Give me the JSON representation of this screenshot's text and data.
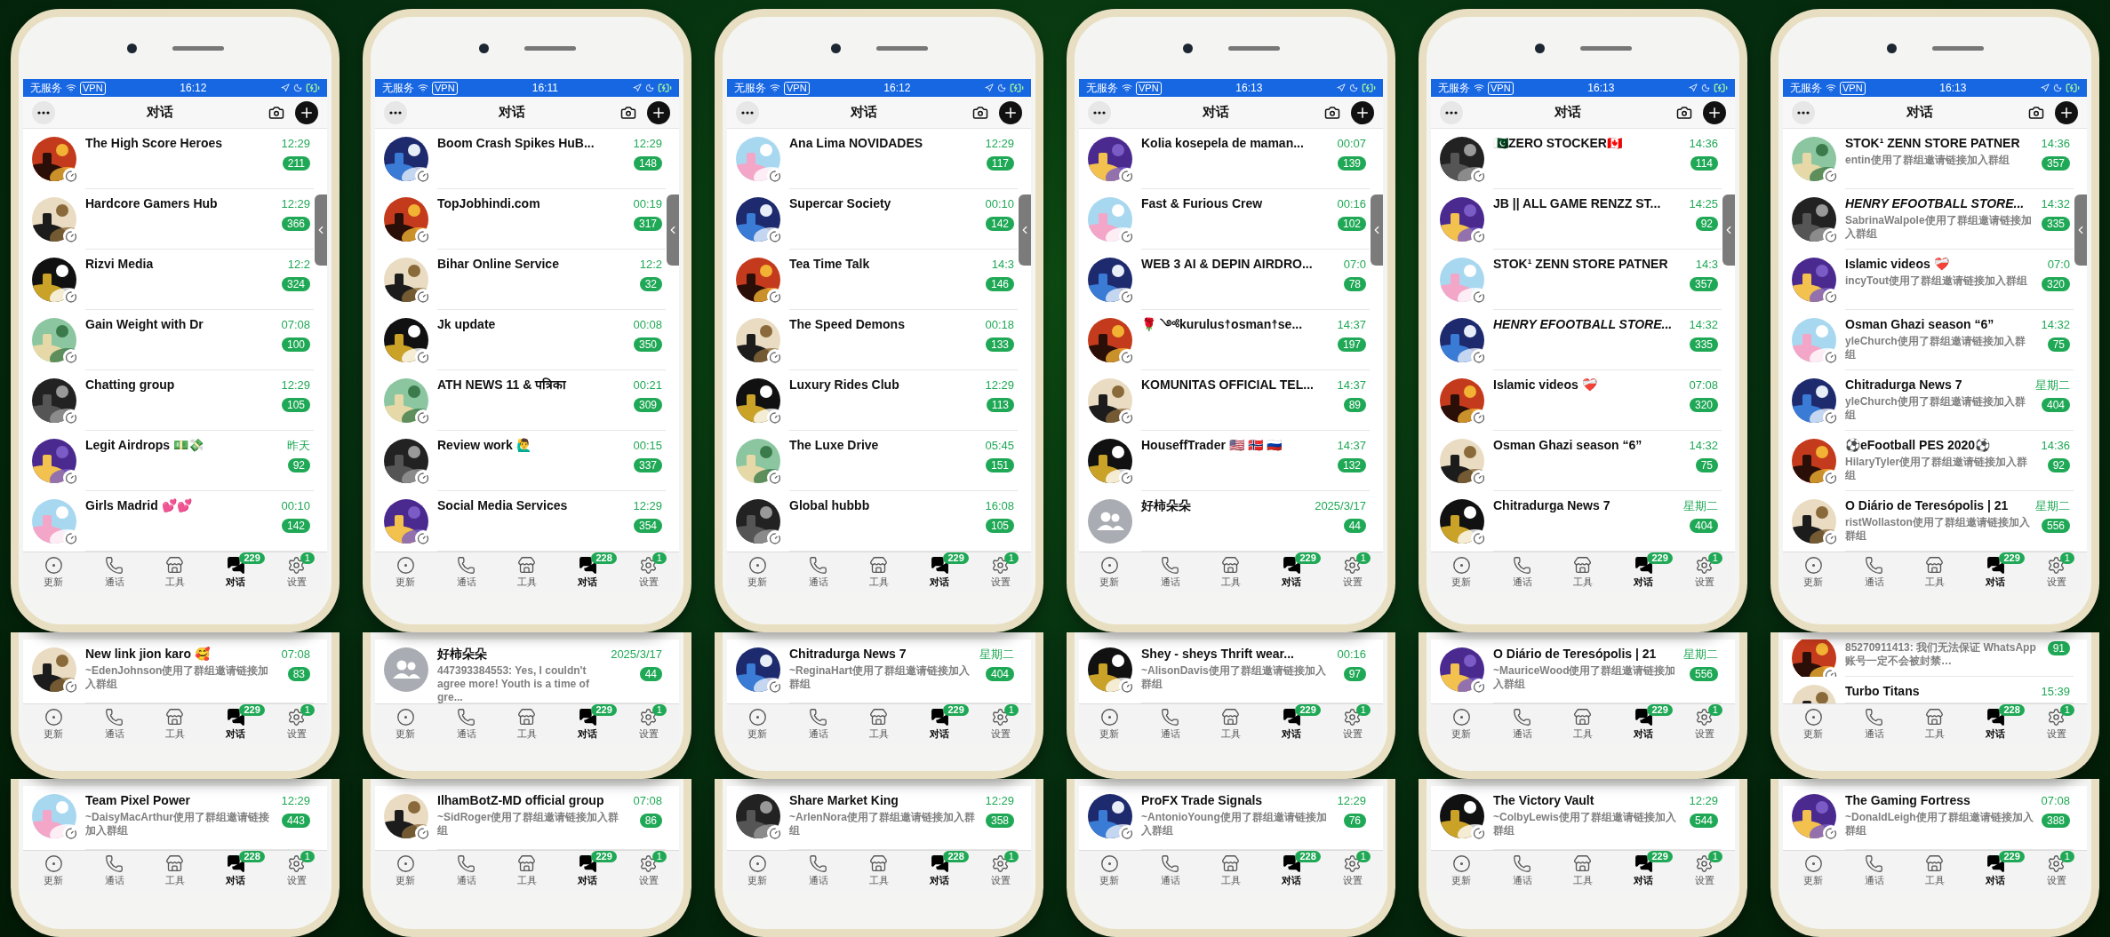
{
  "phones": [
    {
      "status": {
        "carrier": "无服务",
        "vpn": "VPN",
        "time": "16:12"
      },
      "header": {
        "title": "对话"
      },
      "chats": [
        {
          "name": "The High Score Heroes",
          "time": "12:29",
          "count": "211",
          "group": false
        },
        {
          "name": "Hardcore Gamers Hub",
          "time": "12:29",
          "count": "366",
          "group": false
        },
        {
          "name": "Rizvi Media",
          "time": "12:2",
          "count": "324",
          "group": false
        },
        {
          "name": "Gain Weight with Dr",
          "time": "07:08",
          "count": "100",
          "group": false
        },
        {
          "name": "Chatting group",
          "time": "12:29",
          "count": "105",
          "group": false
        },
        {
          "name": "Legit Airdrops 💵💸",
          "time": "昨天",
          "count": "92",
          "group": false
        },
        {
          "name": "Girls Madrid 💕💕",
          "time": "00:10",
          "count": "142",
          "group": false
        }
      ],
      "tabs": [
        {
          "kind": "updates",
          "label": "更新",
          "selected": false
        },
        {
          "kind": "calls",
          "label": "通话",
          "selected": false
        },
        {
          "kind": "tools",
          "label": "工具",
          "selected": false
        },
        {
          "kind": "chats",
          "label": "对话",
          "selected": true,
          "badge": "229"
        },
        {
          "kind": "settings",
          "label": "设置",
          "selected": false,
          "badge": "1"
        }
      ],
      "cards": [
        {
          "chats": [
            {
              "name": "New link jion karo 🥰",
              "preview": "~EdenJohnson使用了群组邀请链接加入群组",
              "time": "07:08",
              "count": "83",
              "group": false
            }
          ],
          "tabs": [
            {
              "kind": "updates",
              "label": "更新",
              "selected": false
            },
            {
              "kind": "calls",
              "label": "通话",
              "selected": false
            },
            {
              "kind": "tools",
              "label": "工具",
              "selected": false
            },
            {
              "kind": "chats",
              "label": "对话",
              "selected": true,
              "badge": "229"
            },
            {
              "kind": "settings",
              "label": "设置",
              "selected": false,
              "badge": "1"
            }
          ]
        },
        {
          "chats": [
            {
              "name": "Team Pixel Power",
              "preview": "~DaisyMacArthur使用了群组邀请链接加入群组",
              "time": "12:29",
              "count": "443",
              "group": false
            }
          ],
          "tabs": [
            {
              "kind": "updates",
              "label": "更新",
              "selected": false
            },
            {
              "kind": "calls",
              "label": "通话",
              "selected": false
            },
            {
              "kind": "tools",
              "label": "工具",
              "selected": false
            },
            {
              "kind": "chats",
              "label": "对话",
              "selected": true,
              "badge": "228"
            },
            {
              "kind": "settings",
              "label": "设置",
              "selected": false,
              "badge": "1"
            }
          ]
        }
      ]
    },
    {
      "status": {
        "carrier": "无服务",
        "vpn": "VPN",
        "time": "16:11"
      },
      "header": {
        "title": "对话"
      },
      "chats": [
        {
          "name": "Boom Crash Spikes HuB...",
          "time": "12:29",
          "count": "148",
          "group": false
        },
        {
          "name": "TopJobhindi.com",
          "time": "00:19",
          "count": "317",
          "group": false
        },
        {
          "name": "Bihar Online Service",
          "time": "12:2",
          "count": "32",
          "group": false
        },
        {
          "name": "Jk update",
          "time": "00:08",
          "count": "350",
          "group": false
        },
        {
          "name": "ATH NEWS 11 & पत्रिका",
          "time": "00:21",
          "count": "309",
          "group": false
        },
        {
          "name": "Review work 🙋‍♂️",
          "time": "00:15",
          "count": "337",
          "group": false
        },
        {
          "name": "Social Media Services",
          "time": "12:29",
          "count": "354",
          "group": false
        }
      ],
      "tabs": [
        {
          "kind": "updates",
          "label": "更新",
          "selected": false
        },
        {
          "kind": "calls",
          "label": "通话",
          "selected": false
        },
        {
          "kind": "tools",
          "label": "工具",
          "selected": false
        },
        {
          "kind": "chats",
          "label": "对话",
          "selected": true,
          "badge": "228"
        },
        {
          "kind": "settings",
          "label": "设置",
          "selected": false,
          "badge": "1"
        }
      ],
      "cards": [
        {
          "chats": [
            {
              "name": "好柿朵朵",
              "preview": "447393384553: Yes, I couldn't agree more! Youth is a time of gre...",
              "time": "2025/3/17",
              "count": "44",
              "group": true
            }
          ],
          "tabs": [
            {
              "kind": "updates",
              "label": "更新",
              "selected": false
            },
            {
              "kind": "calls",
              "label": "通话",
              "selected": false
            },
            {
              "kind": "tools",
              "label": "工具",
              "selected": false
            },
            {
              "kind": "chats",
              "label": "对话",
              "selected": true,
              "badge": "229"
            },
            {
              "kind": "settings",
              "label": "设置",
              "selected": false,
              "badge": "1"
            }
          ]
        },
        {
          "chats": [
            {
              "name": "IlhamBotZ-MD official group",
              "preview": "~SidRoger使用了群组邀请链接加入群组",
              "time": "07:08",
              "count": "86",
              "group": false
            }
          ],
          "tabs": [
            {
              "kind": "updates",
              "label": "更新",
              "selected": false
            },
            {
              "kind": "calls",
              "label": "通话",
              "selected": false
            },
            {
              "kind": "tools",
              "label": "工具",
              "selected": false
            },
            {
              "kind": "chats",
              "label": "对话",
              "selected": true,
              "badge": "229"
            },
            {
              "kind": "settings",
              "label": "设置",
              "selected": false,
              "badge": "1"
            }
          ]
        }
      ]
    },
    {
      "status": {
        "carrier": "无服务",
        "vpn": "VPN",
        "time": "16:12"
      },
      "header": {
        "title": "对话"
      },
      "chats": [
        {
          "name": "Ana Lima NOVIDADES",
          "time": "12:29",
          "count": "117",
          "group": false
        },
        {
          "name": "Supercar Society",
          "time": "00:10",
          "count": "142",
          "group": false
        },
        {
          "name": "Tea Time Talk",
          "time": "14:3",
          "count": "146",
          "group": false
        },
        {
          "name": "The Speed Demons",
          "time": "00:18",
          "count": "133",
          "group": false
        },
        {
          "name": "Luxury Rides Club",
          "time": "12:29",
          "count": "113",
          "group": false
        },
        {
          "name": "The Luxe Drive",
          "time": "05:45",
          "count": "151",
          "group": false
        },
        {
          "name": "Global hubbb",
          "time": "16:08",
          "count": "105",
          "group": false
        }
      ],
      "tabs": [
        {
          "kind": "updates",
          "label": "更新",
          "selected": false
        },
        {
          "kind": "calls",
          "label": "通话",
          "selected": false
        },
        {
          "kind": "tools",
          "label": "工具",
          "selected": false
        },
        {
          "kind": "chats",
          "label": "对话",
          "selected": true,
          "badge": "229"
        },
        {
          "kind": "settings",
          "label": "设置",
          "selected": false,
          "badge": "1"
        }
      ],
      "cards": [
        {
          "chats": [
            {
              "name": "Chitradurga News 7",
              "preview": "~ReginaHart使用了群组邀请链接加入群组",
              "time": "星期二",
              "count": "404",
              "group": false
            }
          ],
          "tabs": [
            {
              "kind": "updates",
              "label": "更新",
              "selected": false
            },
            {
              "kind": "calls",
              "label": "通话",
              "selected": false
            },
            {
              "kind": "tools",
              "label": "工具",
              "selected": false
            },
            {
              "kind": "chats",
              "label": "对话",
              "selected": true,
              "badge": "229"
            },
            {
              "kind": "settings",
              "label": "设置",
              "selected": false,
              "badge": "1"
            }
          ]
        },
        {
          "chats": [
            {
              "name": "Share Market King",
              "preview": "~ArlenNora使用了群组邀请链接加入群组",
              "time": "12:29",
              "count": "358",
              "group": false
            }
          ],
          "tabs": [
            {
              "kind": "updates",
              "label": "更新",
              "selected": false
            },
            {
              "kind": "calls",
              "label": "通话",
              "selected": false
            },
            {
              "kind": "tools",
              "label": "工具",
              "selected": false
            },
            {
              "kind": "chats",
              "label": "对话",
              "selected": true,
              "badge": "228"
            },
            {
              "kind": "settings",
              "label": "设置",
              "selected": false,
              "badge": "1"
            }
          ]
        }
      ]
    },
    {
      "status": {
        "carrier": "无服务",
        "vpn": "VPN",
        "time": "16:13"
      },
      "header": {
        "title": "对话"
      },
      "chats": [
        {
          "name": "Kolia kosepela de maman...",
          "time": "00:07",
          "count": "139",
          "group": false
        },
        {
          "name": "Fast & Furious Crew",
          "time": "00:16",
          "count": "102",
          "group": false
        },
        {
          "name": "WEB 3 AI & DEPIN AIRDRO...",
          "time": "07:0",
          "count": "78",
          "group": false
        },
        {
          "name": "🌹 ༺kurulus☨osman☨se...",
          "time": "14:37",
          "count": "197",
          "group": false
        },
        {
          "name": "KOMUNITAS OFFICIAL TEL...",
          "time": "14:37",
          "count": "89",
          "group": false
        },
        {
          "name": "HouseffTrader 🇺🇸 🇳🇴 🇷🇺",
          "time": "14:37",
          "count": "132",
          "group": false
        },
        {
          "name": "好柿朵朵",
          "time": "2025/3/17",
          "count": "44",
          "group": true
        }
      ],
      "tabs": [
        {
          "kind": "updates",
          "label": "更新",
          "selected": false
        },
        {
          "kind": "calls",
          "label": "通话",
          "selected": false
        },
        {
          "kind": "tools",
          "label": "工具",
          "selected": false
        },
        {
          "kind": "chats",
          "label": "对话",
          "selected": true,
          "badge": "229"
        },
        {
          "kind": "settings",
          "label": "设置",
          "selected": false,
          "badge": "1"
        }
      ],
      "cards": [
        {
          "chats": [
            {
              "name": "Shey - sheys Thrift wear...",
              "preview": "~AlisonDavis使用了群组邀请链接加入群组",
              "time": "00:16",
              "count": "97",
              "group": false
            }
          ],
          "tabs": [
            {
              "kind": "updates",
              "label": "更新",
              "selected": false
            },
            {
              "kind": "calls",
              "label": "通话",
              "selected": false
            },
            {
              "kind": "tools",
              "label": "工具",
              "selected": false
            },
            {
              "kind": "chats",
              "label": "对话",
              "selected": true,
              "badge": "229"
            },
            {
              "kind": "settings",
              "label": "设置",
              "selected": false,
              "badge": "1"
            }
          ]
        },
        {
          "chats": [
            {
              "name": "ProFX Trade Signals",
              "preview": "~AntonioYoung使用了群组邀请链接加入群组",
              "time": "12:29",
              "count": "76",
              "group": false
            }
          ],
          "tabs": [
            {
              "kind": "updates",
              "label": "更新",
              "selected": false
            },
            {
              "kind": "calls",
              "label": "通话",
              "selected": false
            },
            {
              "kind": "tools",
              "label": "工具",
              "selected": false
            },
            {
              "kind": "chats",
              "label": "对话",
              "selected": true,
              "badge": "228"
            },
            {
              "kind": "settings",
              "label": "设置",
              "selected": false,
              "badge": "1"
            }
          ]
        }
      ]
    },
    {
      "status": {
        "carrier": "无服务",
        "vpn": "VPN",
        "time": "16:13"
      },
      "header": {
        "title": "对话"
      },
      "chats": [
        {
          "name": "🇵🇰ZERO STOCKER🇨🇦",
          "time": "14:36",
          "count": "114",
          "group": false
        },
        {
          "name": "JB || ALL GAME RENZZ ST...",
          "time": "14:25",
          "count": "92",
          "group": false
        },
        {
          "name": "STOK¹ ZENN STORE PATNER",
          "time": "14:3",
          "count": "357",
          "group": false
        },
        {
          "name": "HENRY EFOOTBALL STORE...",
          "italic": true,
          "time": "14:32",
          "count": "335",
          "group": false
        },
        {
          "name": "Islamic videos ❤️‍🩹",
          "time": "07:08",
          "count": "320",
          "group": false
        },
        {
          "name": "Osman Ghazi season “6”",
          "time": "14:32",
          "count": "75",
          "group": false
        },
        {
          "name": "Chitradurga News 7",
          "time": "星期二",
          "count": "404",
          "group": false
        }
      ],
      "tabs": [
        {
          "kind": "updates",
          "label": "更新",
          "selected": false
        },
        {
          "kind": "calls",
          "label": "通话",
          "selected": false
        },
        {
          "kind": "tools",
          "label": "工具",
          "selected": false
        },
        {
          "kind": "chats",
          "label": "对话",
          "selected": true,
          "badge": "229"
        },
        {
          "kind": "settings",
          "label": "设置",
          "selected": false,
          "badge": "1"
        }
      ],
      "cards": [
        {
          "chats": [
            {
              "name": "O Diário de Teresópolis | 21",
              "preview": "~MauriceWood使用了群组邀请链接加入群组",
              "time": "星期二",
              "count": "556",
              "group": false
            }
          ],
          "tabs": [
            {
              "kind": "updates",
              "label": "更新",
              "selected": false
            },
            {
              "kind": "calls",
              "label": "通话",
              "selected": false
            },
            {
              "kind": "tools",
              "label": "工具",
              "selected": false
            },
            {
              "kind": "chats",
              "label": "对话",
              "selected": true,
              "badge": "229"
            },
            {
              "kind": "settings",
              "label": "设置",
              "selected": false,
              "badge": "1"
            }
          ]
        },
        {
          "chats": [
            {
              "name": "The Victory Vault",
              "preview": "~ColbyLewis使用了群组邀请链接加入群组",
              "time": "12:29",
              "count": "544",
              "group": false
            }
          ],
          "tabs": [
            {
              "kind": "updates",
              "label": "更新",
              "selected": false
            },
            {
              "kind": "calls",
              "label": "通话",
              "selected": false
            },
            {
              "kind": "tools",
              "label": "工具",
              "selected": false
            },
            {
              "kind": "chats",
              "label": "对话",
              "selected": true,
              "badge": "229"
            },
            {
              "kind": "settings",
              "label": "设置",
              "selected": false,
              "badge": "1"
            }
          ]
        }
      ]
    },
    {
      "status": {
        "carrier": "无服务",
        "vpn": "VPN",
        "time": "16:13"
      },
      "header": {
        "title": "对话"
      },
      "chats": [
        {
          "name": "STOK¹ ZENN STORE PATNER",
          "preview": "entin使用了群组邀请链接加入群组",
          "time": "14:36",
          "count": "357",
          "group": false
        },
        {
          "name": "HENRY EFOOTBALL STORE...",
          "italic": true,
          "preview": "SabrinaWalpole使用了群组邀请链接加入群组",
          "time": "14:32",
          "count": "335",
          "group": false
        },
        {
          "name": "Islamic videos ❤️‍🩹",
          "preview": "incyTout使用了群组邀请链接加入群组",
          "time": "07:0",
          "count": "320",
          "group": false
        },
        {
          "name": "Osman Ghazi season “6”",
          "preview": "yleChurch使用了群组邀请链接加入群组",
          "time": "14:32",
          "count": "75",
          "group": false
        },
        {
          "name": "Chitradurga News 7",
          "preview": "yleChurch使用了群组邀请链接加入群组",
          "time": "星期二",
          "count": "404",
          "group": false
        },
        {
          "name": "⚽eFootball PES 2020⚽",
          "preview": "HilaryTyler使用了群组邀请链接加入群组",
          "time": "14:36",
          "count": "92",
          "group": false
        },
        {
          "name": "O Diário de Teresópolis | 21",
          "preview": "ristWollaston使用了群组邀请链接加入群组",
          "time": "星期二",
          "count": "556",
          "group": false
        }
      ],
      "tabs": [
        {
          "kind": "updates",
          "label": "更新",
          "selected": false
        },
        {
          "kind": "calls",
          "label": "通话",
          "selected": false
        },
        {
          "kind": "tools",
          "label": "工具",
          "selected": false
        },
        {
          "kind": "chats",
          "label": "对话",
          "selected": true,
          "badge": "229"
        },
        {
          "kind": "settings",
          "label": "设置",
          "selected": false,
          "badge": "1"
        }
      ],
      "cards": [
        {
          "chats": [
            {
              "preview": "85270911413: 我们无法保证 WhatsApp 账号一定不会被封禁…",
              "count": "91",
              "group": false
            },
            {
              "name": "Turbo Titans",
              "time": "15:39",
              "group": false
            }
          ],
          "tabs": [
            {
              "kind": "updates",
              "label": "更新",
              "selected": false
            },
            {
              "kind": "calls",
              "label": "通话",
              "selected": false
            },
            {
              "kind": "tools",
              "label": "工具",
              "selected": false
            },
            {
              "kind": "chats",
              "label": "对话",
              "selected": true,
              "badge": "228"
            },
            {
              "kind": "settings",
              "label": "设置",
              "selected": false,
              "badge": "1"
            }
          ]
        },
        {
          "chats": [
            {
              "name": "The Gaming Fortress",
              "preview": "~DonaldLeigh使用了群组邀请链接加入群组",
              "time": "07:08",
              "count": "388",
              "group": false
            }
          ],
          "tabs": [
            {
              "kind": "updates",
              "label": "更新",
              "selected": false
            },
            {
              "kind": "calls",
              "label": "通话",
              "selected": false
            },
            {
              "kind": "tools",
              "label": "工具",
              "selected": false
            },
            {
              "kind": "chats",
              "label": "对话",
              "selected": true,
              "badge": "229"
            },
            {
              "kind": "settings",
              "label": "设置",
              "selected": false,
              "badge": "1"
            }
          ]
        }
      ]
    }
  ]
}
